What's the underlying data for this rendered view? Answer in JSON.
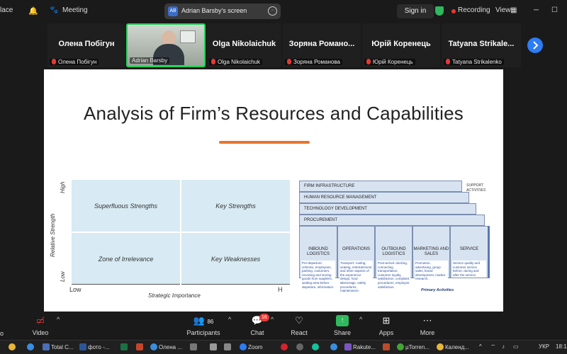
{
  "topbar": {
    "left_fragment": "lace",
    "meeting_label": "Meeting",
    "screen_share": {
      "initials": "AB",
      "label": "Adrian Barsby's screen"
    },
    "sign_in": "Sign in",
    "recording": "Recording",
    "view": "View"
  },
  "gallery": {
    "tiles": [
      {
        "big": "Олена Побігун",
        "small": "Олена Побігун",
        "muted": true
      },
      {
        "big": "",
        "small": "Adrian Barsby",
        "muted": false,
        "video": true
      },
      {
        "big": "Olga Nikolaichuk",
        "small": "Olga Nikolaichuk",
        "muted": true
      },
      {
        "big": "Зоряна Романо...",
        "small": "Зоряна Романова",
        "muted": true
      },
      {
        "big": "Юрій Коренець",
        "small": "Юрій Коренець",
        "muted": true
      },
      {
        "big": "Tatyana Strikale...",
        "small": "Tatyana Strikalenko",
        "muted": true
      }
    ]
  },
  "slide": {
    "title": "Analysis of Firm’s Resources and Capabilities",
    "matrix": {
      "y_axis_label": "Relative Strength",
      "y_high": "High",
      "y_low": "Low",
      "x_axis_label": "Strategic Importance",
      "x_low": "Low",
      "x_high": "H",
      "cells": {
        "top_left": "Superfluous Strengths",
        "top_right": "Key Strengths",
        "bottom_left": "Zone of Irrelevance",
        "bottom_right": "Key Weaknesses"
      }
    },
    "value_chain": {
      "support_label": "SUPPORT ACTIVITIES",
      "support": [
        "FIRM INFRASTRUCTURE",
        "HUMAN RESOURCE MANAGEMENT",
        "TECHNOLOGY DEVELOPMENT",
        "PROCUREMENT"
      ],
      "primary_label": "Primary Activities",
      "primary": [
        {
          "name": "INBOUND LOGISTICS",
          "desc": "Pre-departure: vehicles, employees, parking, customers, receiving and storing goods from suppliers, waiting area before departure, information."
        },
        {
          "name": "OPERATIONS",
          "desc": "Transport: routing, seating, entertainment and other aspects of the experience design, food &beverage, safety procedures, maintenance."
        },
        {
          "name": "OUTBOUND LOGISTICS",
          "desc": "Post-arrival: docking, connecting transportation, customer loyalty, satisfaction, complaint procedures, employee satisfaction."
        },
        {
          "name": "MARKETING AND SALES",
          "desc": "Promotion, advertising, group sales, brand development, market research."
        },
        {
          "name": "SERVICE",
          "desc": "Service quality and customer service before, during and after the service."
        }
      ]
    }
  },
  "controls": {
    "left_fragment": "o",
    "video": "Video",
    "participants": "Participants",
    "participants_count": "86",
    "chat": "Chat",
    "chat_badge": "16",
    "react": "React",
    "share": "Share",
    "apps": "Apps",
    "more": "More"
  },
  "taskbar": {
    "items": [
      "Total C...",
      "фото -...",
      "Олена ...",
      "Zoom",
      "Rakute...",
      "µTorren...",
      "Календ..."
    ],
    "lang": "УКР",
    "time": "18:1"
  },
  "colors": {
    "accent_orange": "#e8752d",
    "matrix_fill": "#d8eaf3",
    "chain_fill": "#d8e3f2",
    "zoom_blue": "#2d7cf5",
    "rec_red": "#e53935",
    "share_green": "#2fb95c"
  }
}
